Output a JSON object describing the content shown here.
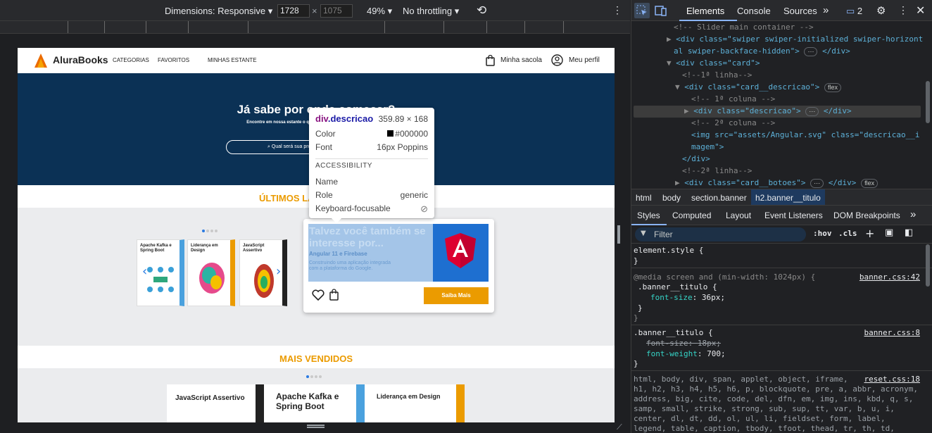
{
  "toolbar": {
    "dimensions_label": "Dimensions: Responsive",
    "width_value": "1728",
    "times": "×",
    "height_placeholder": "1075",
    "zoom": "49%",
    "throttling": "No throttling"
  },
  "page": {
    "logo": "AluraBooks",
    "nav_items": [
      "CATEGORIAS",
      "FAVORITOS",
      "MINHAS ESTANTE"
    ],
    "cart_label": "Minha sacola",
    "profile_label": "Meu perfil",
    "hero_title": "Já sabe por onde começar?",
    "hero_sub": "Encontre em nossa estante o que precisa para seu desenvolvimento!",
    "search_placeholder": "Qual será sua próxima leitura?",
    "section1_title": "ÚLTIMOS LANÇAMENTOS",
    "section2_title": "MAIS VENDIDOS",
    "books_row1": [
      "Apache Kafka e Spring Boot",
      "Liderança em Design",
      "JavaScript Assertivo"
    ],
    "books_row2": [
      "JavaScript Assertivo",
      "Apache Kafka e Spring Boot",
      "Liderança em Design"
    ],
    "card": {
      "heading": "Talvez você também se interesse por...",
      "book_title": "Angular 11 e Firebase",
      "book_desc": "Construindo uma aplicação integrada com a plataforma do Google.",
      "button": "Saiba Mais"
    }
  },
  "tooltip": {
    "element": "div",
    "class": ".descricao",
    "size": "359.89 × 168",
    "color_label": "Color",
    "color_value": "#000000",
    "font_label": "Font",
    "font_value": "16px Poppins",
    "section": "ACCESSIBILITY",
    "name_label": "Name",
    "role_label": "Role",
    "role_value": "generic",
    "kbd_label": "Keyboard-focusable"
  },
  "devtools": {
    "tabs": [
      "Elements",
      "Console",
      "Sources"
    ],
    "issues_count": "2",
    "breadcrumb": [
      "html",
      "body",
      "section.banner",
      "h2.banner__titulo"
    ],
    "style_tabs": [
      "Styles",
      "Computed",
      "Layout",
      "Event Listeners",
      "DOM Breakpoints"
    ],
    "filter_placeholder": "Filter",
    "hov": ":hov",
    "cls": ".cls",
    "dom_lines": [
      "<!-- Slider main container -->",
      "<div class=\"swiper swiper-initialized swiper-horizont",
      "al swiper-backface-hidden\">",
      "<div class=\"card\">",
      "<!--1ª linha-->",
      "<div class=\"card__descricao\">",
      "<!-- 1ª coluna -->",
      "<div class=\"descricao\">",
      "<!-- 2ª coluna -->",
      "<img src=\"assets/Angular.svg\" class=\"descricao__i",
      "magem\">",
      "</div>",
      "<!--2ª linha-->",
      "<div class=\"card__botoes\">"
    ],
    "badge_flex": "flex",
    "rules": {
      "element_style": "element.style {",
      "media": "@media screen and (min-width: 1024px) {",
      "media_sel": ".banner__titulo {",
      "media_prop": "font-size",
      "media_val": "36px",
      "media_src": "banner.css:42",
      "rule2_sel": ".banner__titulo {",
      "rule2_src": "banner.css:8",
      "rule2_prop1": "font-size",
      "rule2_val1": "18px",
      "rule2_prop2": "font-weight",
      "rule2_val2": "700",
      "reset_src": "reset.css:18",
      "reset_lines": [
        "html, body, div, span, applet, object, iframe,",
        "h1, h2, h3, h4, h5, h6, p, blockquote, pre, a, abbr, acronym,",
        "address, big, cite, code, del, dfn, em, img, ins, kbd, q, s,",
        "samp, small, strike, strong, sub, sup, tt, var, b, u, i,",
        "center, dl, dt, dd, ol, ul, li, fieldset, form, label,",
        "legend, table, caption, tbody, tfoot, thead, tr, th, td,"
      ]
    }
  },
  "colors": {
    "orange": "#eb9b00",
    "navy": "#0b3155",
    "angular": "#dd0031"
  }
}
